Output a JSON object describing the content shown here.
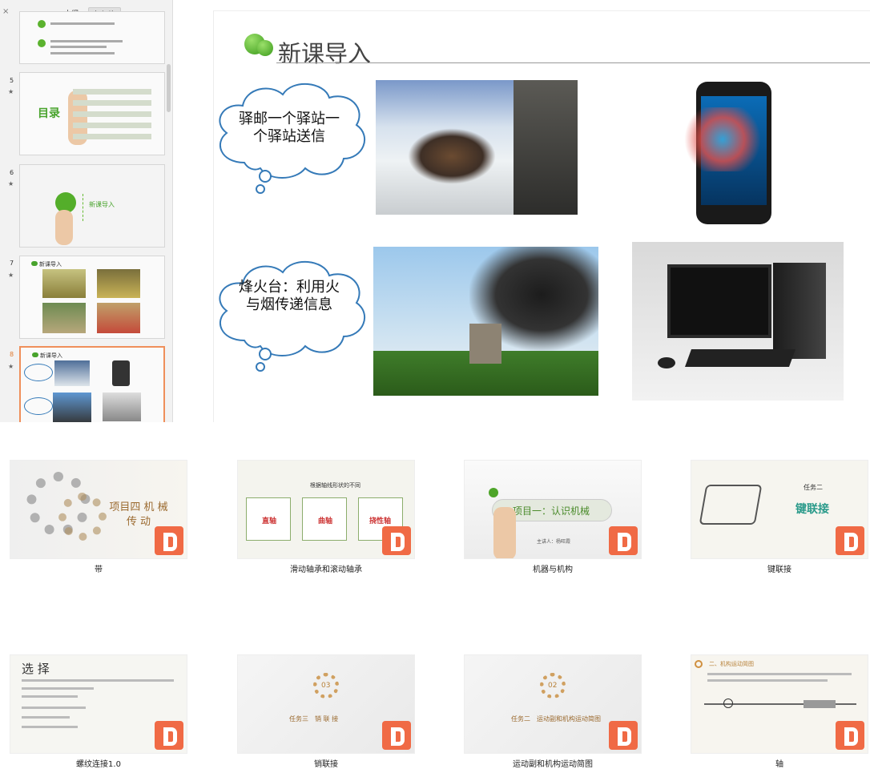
{
  "sidebar": {
    "close_icon": "×",
    "tabs": [
      {
        "label": "大纲"
      },
      {
        "label": "幻灯片"
      }
    ],
    "slides": [
      {
        "num": "5",
        "mini_title": "目录"
      },
      {
        "num": "6",
        "mini_title": "新课导入"
      },
      {
        "num": "7",
        "mini_title": "新课导入"
      },
      {
        "num": "8",
        "mini_title": "新课导入"
      }
    ]
  },
  "slide": {
    "title": "新课导入",
    "cloud1": "驿邮一个驿站一个驿站送信",
    "cloud2": "烽火台：利用火与烟传递信息"
  },
  "gallery": [
    {
      "label": "带",
      "thumb_text": "项目四 机 械 传 动"
    },
    {
      "label": "滑动轴承和滚动轴承",
      "thumb_text": "根据轴线形状的不同",
      "boxes": [
        "直轴",
        "曲轴",
        "挠性轴"
      ]
    },
    {
      "label": "机器与机构",
      "thumb_text": "项目一：认识机械",
      "sub": "主讲人：杨旺霞"
    },
    {
      "label": "键联接",
      "thumb_text": "键联接",
      "sub": "任务二"
    },
    {
      "label": "螺纹连接1.0",
      "thumb_text": "选 择"
    },
    {
      "label": "销联接",
      "thumb_text": "任务三　销 联 接",
      "num": "03"
    },
    {
      "label": "运动副和机构运动简图",
      "thumb_text": "任务二　运动副和机构运动简图",
      "num": "02"
    },
    {
      "label": "轴",
      "thumb_text": "二、机构运动简图"
    }
  ]
}
